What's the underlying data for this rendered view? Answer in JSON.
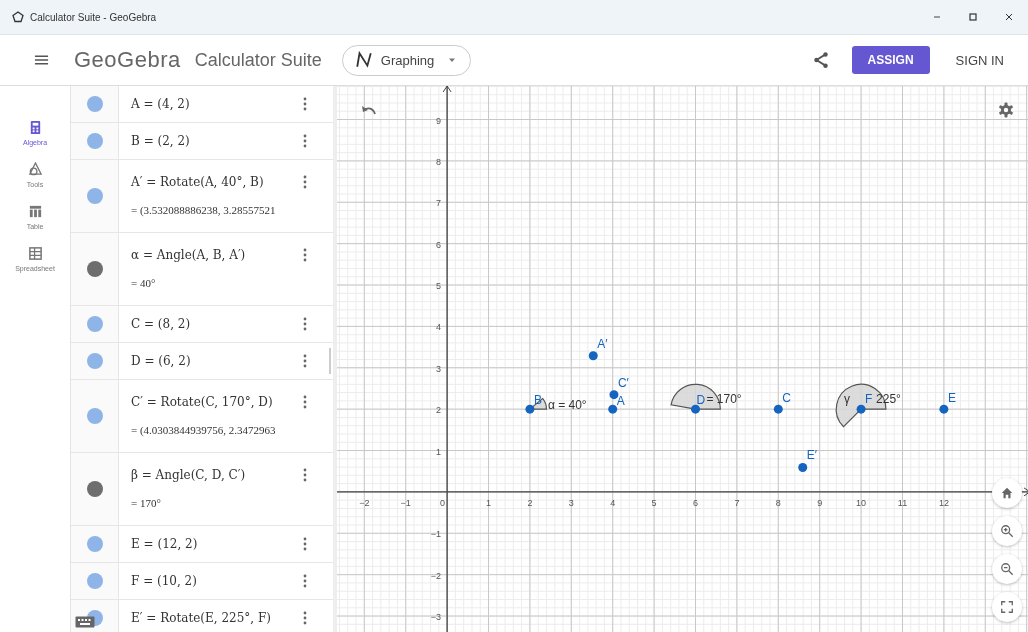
{
  "window": {
    "title": "Calculator Suite - GeoGebra"
  },
  "header": {
    "logo": "GeoGebra",
    "app_name": "Calculator Suite",
    "app_switcher": "Graphing",
    "assign_button": "ASSIGN",
    "sign_in": "SIGN IN"
  },
  "rail": [
    {
      "label": "Algebra",
      "kind": "algebra",
      "selected": true
    },
    {
      "label": "Tools",
      "kind": "tools",
      "selected": false
    },
    {
      "label": "Table",
      "kind": "table",
      "selected": false
    },
    {
      "label": "Spreadsheet",
      "kind": "spreadsheet",
      "selected": false
    }
  ],
  "algebra": [
    {
      "input": "A = (4, 2)",
      "color": "#8fb4e8"
    },
    {
      "input": "B = (2, 2)",
      "color": "#8fb4e8"
    },
    {
      "input": "A′ = Rotate(A, 40°, B)",
      "output": "= (3.532088886238, 3.28557521",
      "color": "#8fb4e8"
    },
    {
      "input": "α = Angle(A, B, A′)",
      "output": "= 40°",
      "color": "#6e6e6e"
    },
    {
      "input": "C = (8, 2)",
      "color": "#8fb4e8"
    },
    {
      "input": "D = (6, 2)",
      "color": "#8fb4e8"
    },
    {
      "input": "C′ = Rotate(C, 170°, D)",
      "output": "= (4.0303844939756, 2.3472963",
      "color": "#8fb4e8"
    },
    {
      "input": "β = Angle(C, D, C′)",
      "output": "= 170°",
      "color": "#6e6e6e"
    },
    {
      "input": "E = (12, 2)",
      "color": "#8fb4e8"
    },
    {
      "input": "F = (10, 2)",
      "color": "#8fb4e8"
    },
    {
      "input": "E′ = Rotate(E, 225°, F)",
      "color": "#8fb4e8"
    }
  ],
  "graph": {
    "chart_data": {
      "type": "scatter",
      "x": [
        4,
        2,
        3.53,
        8,
        6,
        4.03,
        12,
        10,
        8.59
      ],
      "values": [
        2,
        2,
        3.29,
        2,
        2,
        2.35,
        2,
        2,
        0.59
      ],
      "grid": true,
      "xlim": [
        -2.66,
        14.08
      ],
      "ylim": [
        -3.41,
        9.81
      ],
      "xticks": [
        -2,
        -1,
        0,
        1,
        2,
        3,
        4,
        5,
        6,
        7,
        8,
        9,
        10,
        11,
        12
      ],
      "yticks": [
        -3,
        -2,
        -1,
        1,
        2,
        3,
        4,
        5,
        6,
        7,
        8,
        9
      ],
      "annotations": [
        {
          "text": "A′",
          "x": 3.53,
          "y": 3.29
        },
        {
          "text": "C′",
          "x": 4.03,
          "y": 2.35
        },
        {
          "text": "B",
          "x": 2,
          "y": 2
        },
        {
          "text": "α = 40°",
          "x": 2,
          "y": 2
        },
        {
          "text": "A",
          "x": 4,
          "y": 2
        },
        {
          "text": "D",
          "x": 6,
          "y": 2
        },
        {
          "text": "= 170°",
          "x": 6,
          "y": 2
        },
        {
          "text": "C",
          "x": 8,
          "y": 2
        },
        {
          "text": "γ",
          "x": 10,
          "y": 2
        },
        {
          "text": "F",
          "x": 10,
          "y": 2
        },
        {
          "text": "225°",
          "x": 10,
          "y": 2
        },
        {
          "text": "E",
          "x": 12,
          "y": 2
        },
        {
          "text": "E′",
          "x": 8.59,
          "y": 0.59
        }
      ]
    }
  }
}
